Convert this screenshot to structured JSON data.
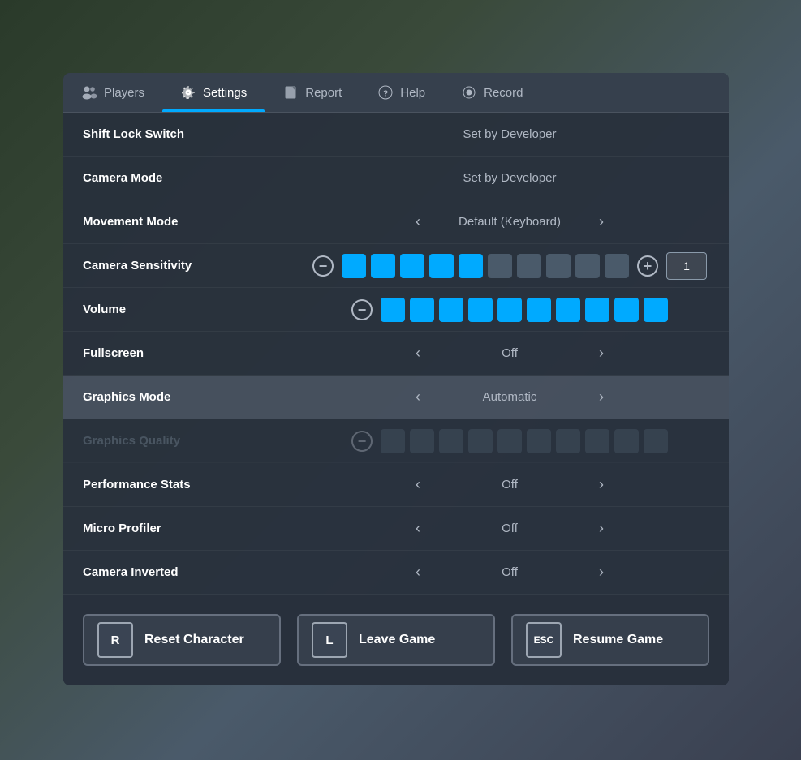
{
  "background": {
    "color": "#3a4a5a"
  },
  "tabs": [
    {
      "id": "players",
      "label": "Players",
      "icon": "players-icon",
      "active": false
    },
    {
      "id": "settings",
      "label": "Settings",
      "icon": "settings-icon",
      "active": true
    },
    {
      "id": "report",
      "label": "Report",
      "icon": "report-icon",
      "active": false
    },
    {
      "id": "help",
      "label": "Help",
      "icon": "help-icon",
      "active": false
    },
    {
      "id": "record",
      "label": "Record",
      "icon": "record-icon",
      "active": false
    }
  ],
  "settings": [
    {
      "id": "shift-lock-switch",
      "label": "Shift Lock Switch",
      "type": "text",
      "value": "Set by Developer",
      "disabled": false,
      "highlighted": false
    },
    {
      "id": "camera-mode",
      "label": "Camera Mode",
      "type": "text",
      "value": "Set by Developer",
      "disabled": false,
      "highlighted": false
    },
    {
      "id": "movement-mode",
      "label": "Movement Mode",
      "type": "arrow",
      "value": "Default (Keyboard)",
      "disabled": false,
      "highlighted": false
    },
    {
      "id": "camera-sensitivity",
      "label": "Camera Sensitivity",
      "type": "slider",
      "activeDots": 5,
      "totalDots": 10,
      "inputValue": "1",
      "disabled": false,
      "highlighted": false
    },
    {
      "id": "volume",
      "label": "Volume",
      "type": "slider-no-input",
      "activeDots": 10,
      "totalDots": 10,
      "disabled": false,
      "highlighted": false
    },
    {
      "id": "fullscreen",
      "label": "Fullscreen",
      "type": "arrow",
      "value": "Off",
      "disabled": false,
      "highlighted": false
    },
    {
      "id": "graphics-mode",
      "label": "Graphics Mode",
      "type": "arrow",
      "value": "Automatic",
      "disabled": false,
      "highlighted": true
    },
    {
      "id": "graphics-quality",
      "label": "Graphics Quality",
      "type": "slider-disabled",
      "activeDots": 0,
      "totalDots": 10,
      "disabled": true,
      "highlighted": false
    },
    {
      "id": "performance-stats",
      "label": "Performance Stats",
      "type": "arrow",
      "value": "Off",
      "disabled": false,
      "highlighted": false
    },
    {
      "id": "micro-profiler",
      "label": "Micro Profiler",
      "type": "arrow",
      "value": "Off",
      "disabled": false,
      "highlighted": false
    },
    {
      "id": "camera-inverted",
      "label": "Camera Inverted",
      "type": "arrow",
      "value": "Off",
      "disabled": false,
      "highlighted": false
    }
  ],
  "buttons": [
    {
      "id": "reset-character",
      "key": "R",
      "label": "Reset Character"
    },
    {
      "id": "leave-game",
      "key": "L",
      "label": "Leave Game"
    },
    {
      "id": "resume-game",
      "key": "ESC",
      "label": "Resume Game"
    }
  ],
  "colors": {
    "active_dot": "#00aaff",
    "inactive_dot": "#4a5a6a",
    "tab_active_line": "#00aaff"
  }
}
